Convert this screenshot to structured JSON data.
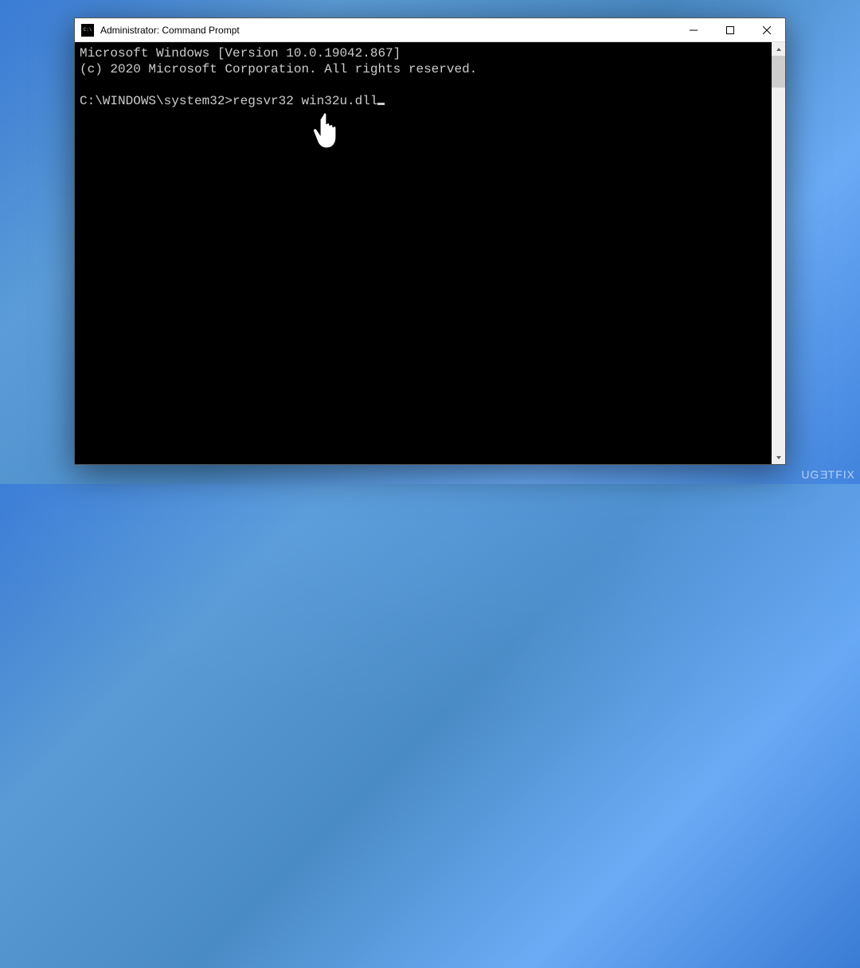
{
  "window": {
    "title": "Administrator: Command Prompt"
  },
  "terminal": {
    "line1": "Microsoft Windows [Version 10.0.19042.867]",
    "line2": "(c) 2020 Microsoft Corporation. All rights reserved.",
    "blank": "",
    "prompt": "C:\\WINDOWS\\system32>",
    "command": "regsvr32 win32u.dll"
  },
  "watermark": {
    "text": "UGETFIX"
  }
}
